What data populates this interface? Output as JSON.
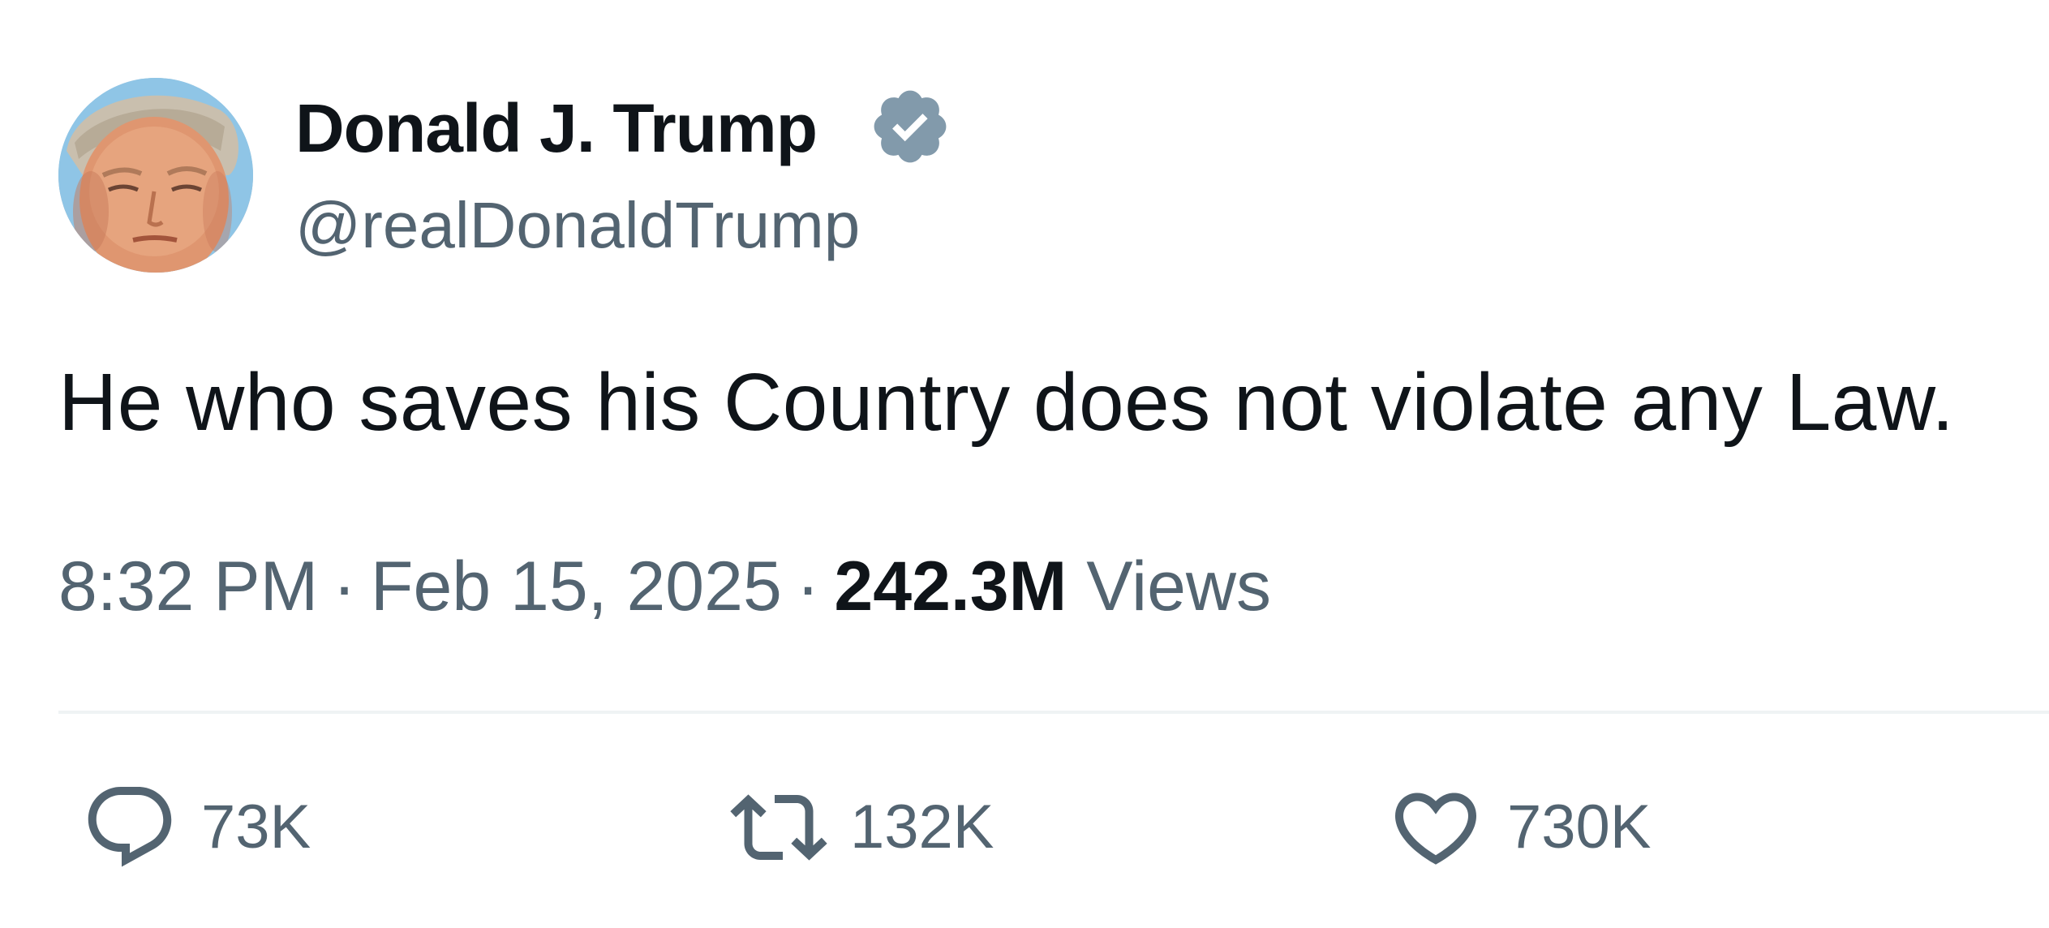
{
  "tweet": {
    "author": {
      "display_name": "Donald J. Trump",
      "handle": "@realDonaldTrump",
      "verified": true,
      "verified_color": "#829aab"
    },
    "text": "He who saves his Country does not violate any Law.",
    "time": "8:32 PM",
    "date": "Feb 15, 2025",
    "separator": "·",
    "views_count": "242.3M",
    "views_label": "Views",
    "actions": {
      "reply_count": "73K",
      "retweet_count": "132K",
      "like_count": "730K"
    },
    "icons": {
      "reply": "speech-bubble-icon",
      "retweet": "retweet-arrows-icon",
      "like": "heart-icon",
      "verified": "verified-badge-icon"
    },
    "colors": {
      "text_primary": "#0f1419",
      "text_secondary": "#536471",
      "divider": "#eff3f4"
    }
  }
}
